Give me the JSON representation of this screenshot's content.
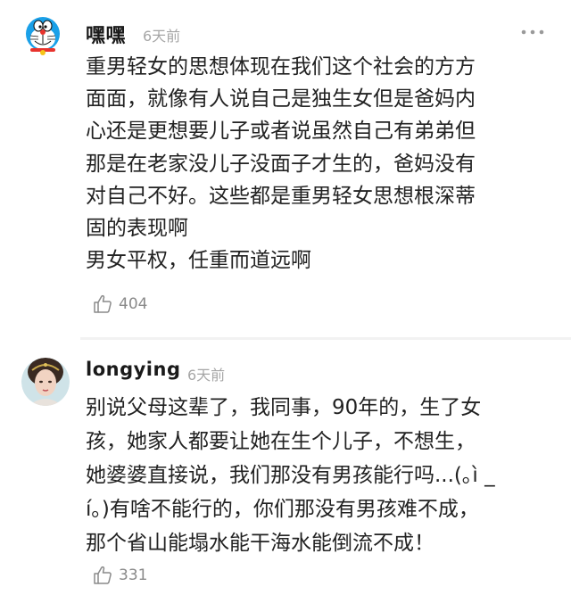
{
  "comments": [
    {
      "username": "嘿嘿",
      "time": "6天前",
      "text": "重男轻女的思想体现在我们这个社会的方方\n面面，就像有人说自己是独生女但是爸妈内\n心还是更想要儿子或者说虽然自己有弟弟但\n那是在老家没儿子没面子才生的，爸妈没有\n对自己不好。这些都是重男轻女思想根深蒂\n固的表现啊\n男女平权，任重而道远啊",
      "likes": "404",
      "avatar_icon": "doraemon-avatar"
    },
    {
      "username": "longying",
      "time": "6天前",
      "text": "别说父母这辈了，我同事，90年的，生了女\n孩，她家人都要让她在生个儿子，不想生，\n她婆婆直接说，我们那没有男孩能行吗...(｡ì _\ní｡)有啥不能行的，你们那没有男孩难不成，\n那个省山能塌水能干海水能倒流不成！",
      "likes": "331",
      "avatar_icon": "portrait-avatar"
    }
  ],
  "icons": {
    "more": "more-dots-icon",
    "like": "thumbs-up-icon"
  },
  "colors": {
    "time": "#a6a6a6",
    "text": "#222222",
    "like": "#8a8a8a"
  }
}
